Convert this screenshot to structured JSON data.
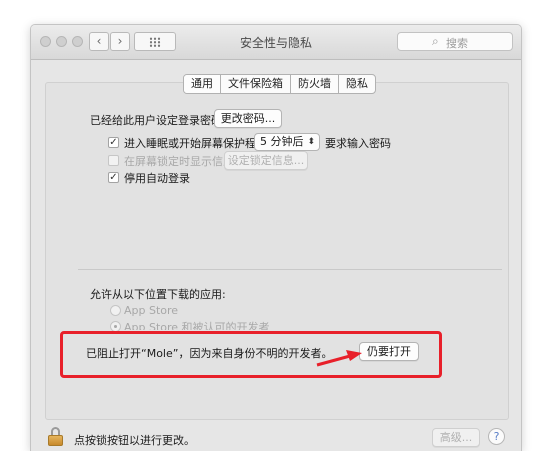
{
  "window": {
    "title": "安全性与隐私",
    "back_icon": "‹",
    "forward_icon": "›",
    "search_placeholder": "搜索",
    "search_icon": "⌕"
  },
  "tabs": [
    {
      "label": "通用",
      "active": true
    },
    {
      "label": "文件保险箱",
      "active": false
    },
    {
      "label": "防火墙",
      "active": false
    },
    {
      "label": "隐私",
      "active": false
    }
  ],
  "general": {
    "password_label": "已经给此用户设定登录密码",
    "change_password_button": "更改密码...",
    "require_password": {
      "checked": true,
      "label_prefix": "进入睡眠或开始屏幕保护程序",
      "delay_value": "5 分钟后",
      "label_suffix": "要求输入密码"
    },
    "show_message": {
      "checked": false,
      "label": "在屏幕锁定时显示信息"
    },
    "set_lock_message_button": "设定锁定信息...",
    "disable_auto_login": {
      "checked": true,
      "label": "停用自动登录"
    },
    "check_mark": "✓"
  },
  "downloads": {
    "heading": "允许从以下位置下载的应用:",
    "options": [
      {
        "label": "App Store",
        "selected": false
      },
      {
        "label": "App Store 和被认可的开发者",
        "selected": true
      }
    ],
    "blocked_message": "已阻止打开“Mole”，因为来自身份不明的开发者。",
    "open_anyway_button": "仍要打开"
  },
  "footer": {
    "lock_text": "点按锁按钮以进行更改。",
    "advanced_button": "高级...",
    "help_icon": "?"
  },
  "colors": {
    "highlight": "#e8202a"
  }
}
